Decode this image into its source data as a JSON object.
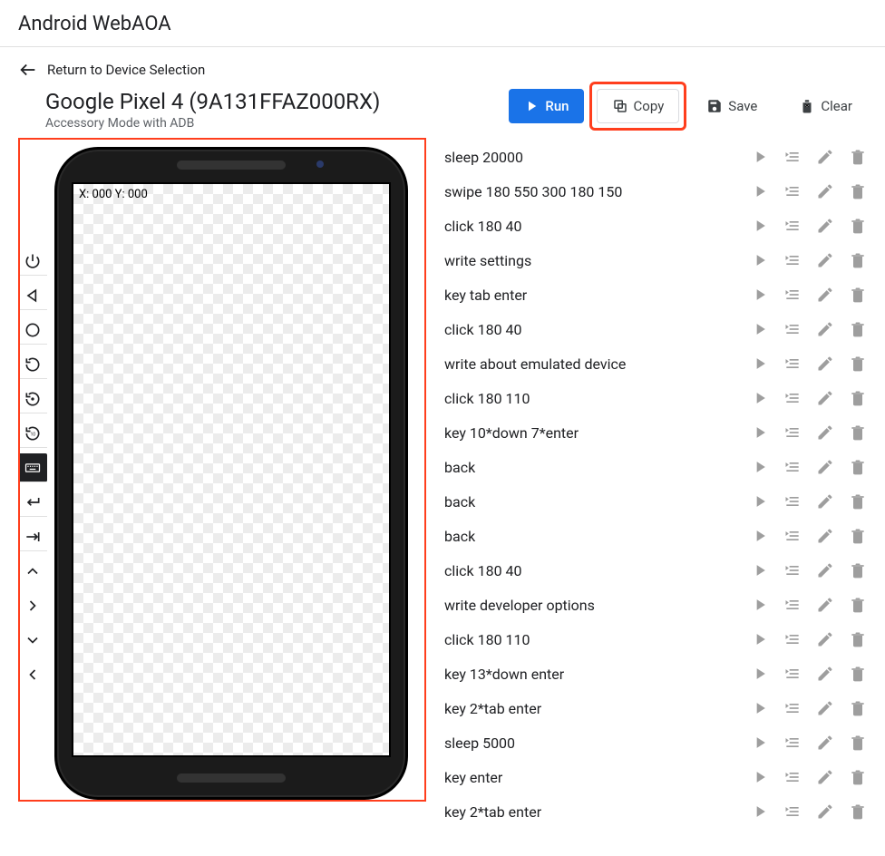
{
  "app_title": "Android WebAOA",
  "return_label": "Return to Device Selection",
  "device": {
    "name": "Google Pixel 4 (9A131FFAZ000RX)",
    "mode": "Accessory Mode with ADB",
    "coord_label": "X: 000 Y: 000"
  },
  "toolbar": {
    "run": "Run",
    "copy": "Copy",
    "save": "Save",
    "clear": "Clear"
  },
  "actions": [
    {
      "cmd": "sleep 20000"
    },
    {
      "cmd": "swipe 180 550 300 180 150"
    },
    {
      "cmd": "click 180 40"
    },
    {
      "cmd": "write settings"
    },
    {
      "cmd": "key tab enter"
    },
    {
      "cmd": "click 180 40"
    },
    {
      "cmd": "write about emulated device"
    },
    {
      "cmd": "click 180 110"
    },
    {
      "cmd": "key 10*down 7*enter"
    },
    {
      "cmd": "back"
    },
    {
      "cmd": "back"
    },
    {
      "cmd": "back"
    },
    {
      "cmd": "click 180 40"
    },
    {
      "cmd": "write developer options"
    },
    {
      "cmd": "click 180 110"
    },
    {
      "cmd": "key 13*down enter"
    },
    {
      "cmd": "key 2*tab enter"
    },
    {
      "cmd": "sleep 5000"
    },
    {
      "cmd": "key enter"
    },
    {
      "cmd": "key 2*tab enter"
    }
  ]
}
